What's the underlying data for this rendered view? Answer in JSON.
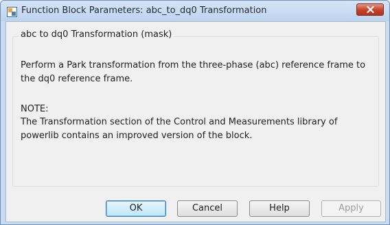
{
  "window": {
    "title": "Function Block Parameters: abc_to_dq0 Transformation",
    "icon": "simulink-block-icon",
    "close_icon": "close-icon"
  },
  "mask": {
    "group_title": "abc to dq0 Transformation (mask)",
    "description": "Perform a Park transformation from the three-phase (abc) reference frame to the dq0 reference frame.",
    "note_label": "NOTE:",
    "note_text": "The Transformation section of the Control and Measurements library of powerlib contains an improved version of the block."
  },
  "buttons": {
    "ok": "OK",
    "cancel": "Cancel",
    "help": "Help",
    "apply": "Apply"
  }
}
